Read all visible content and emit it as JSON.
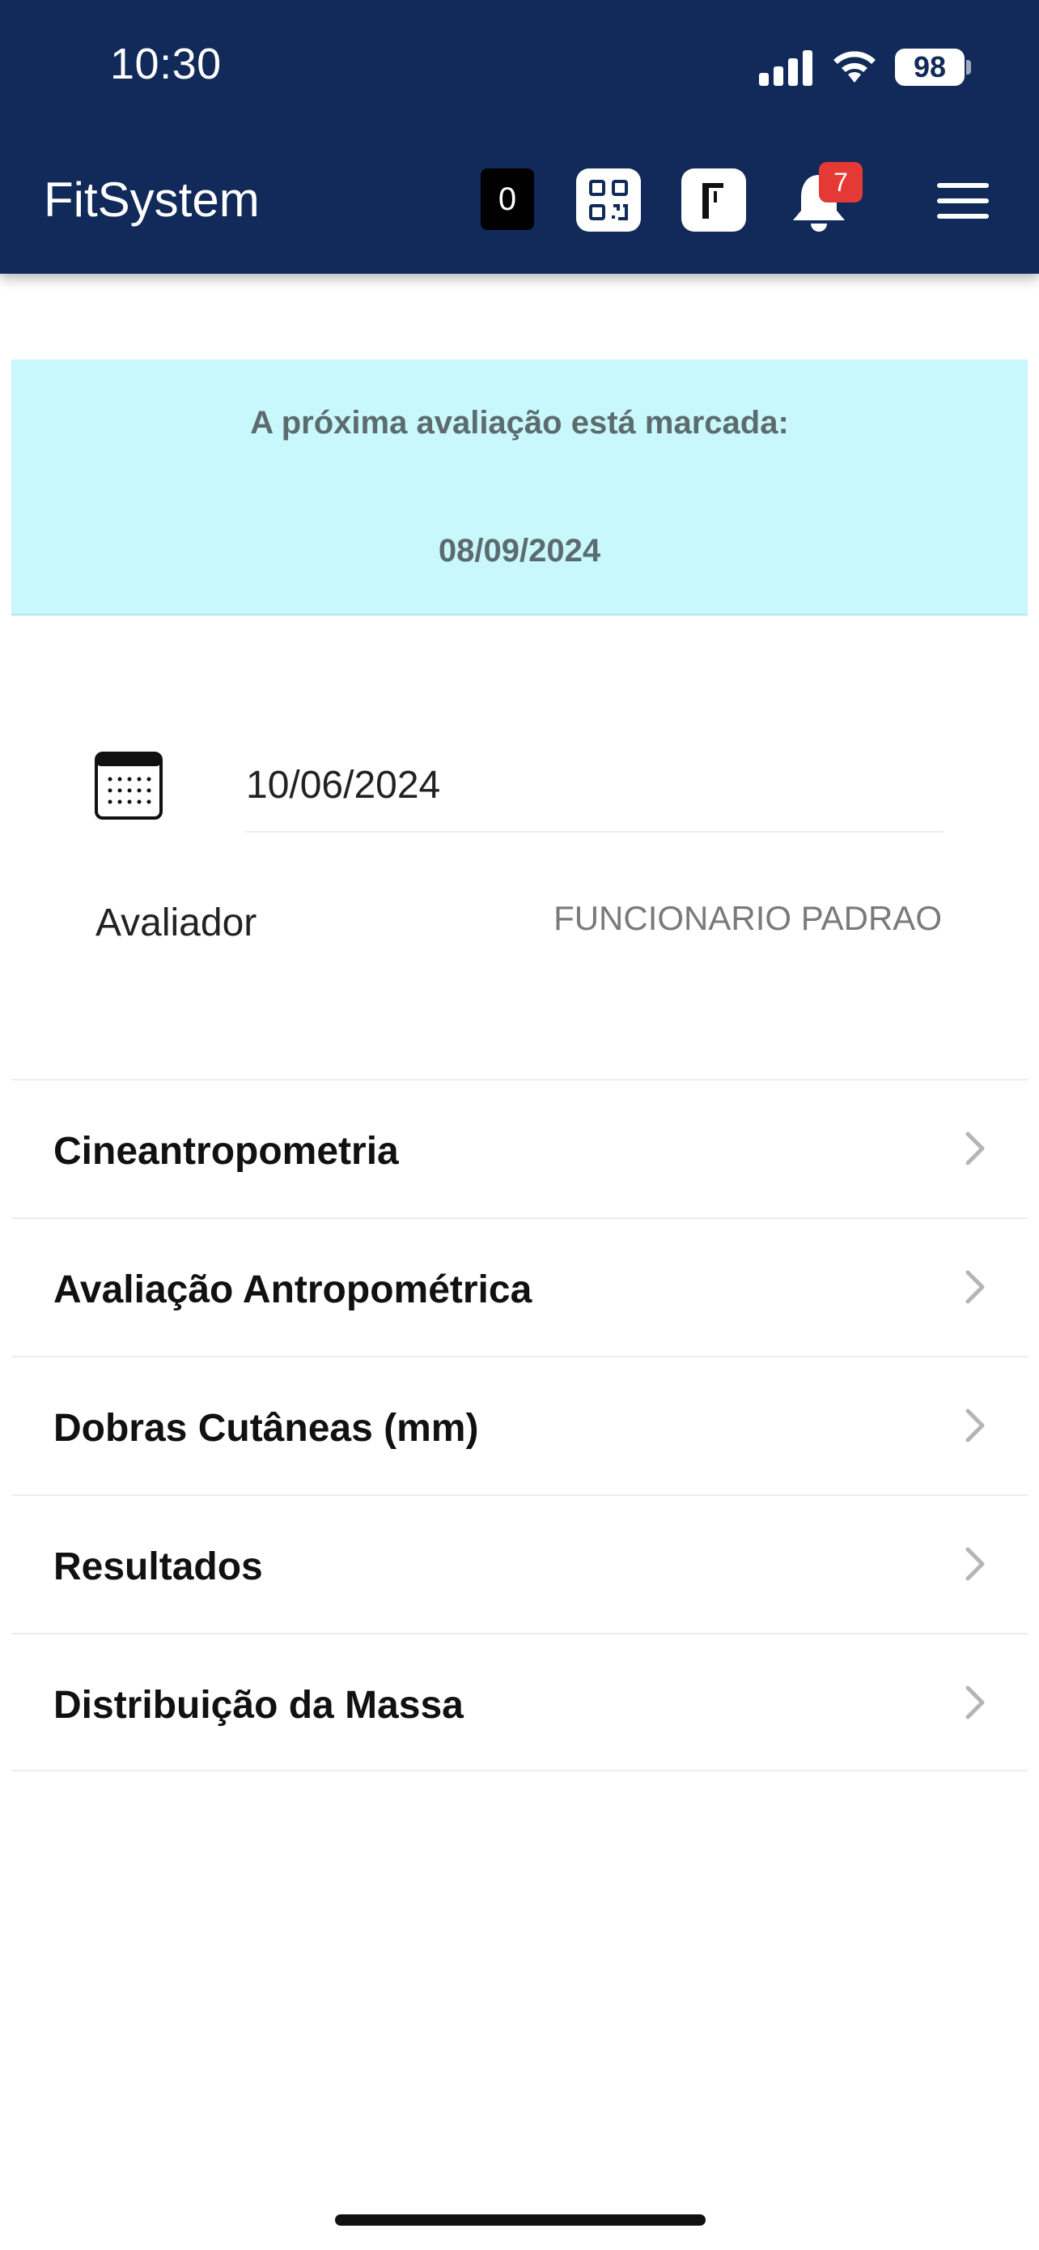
{
  "status_bar": {
    "time": "10:30",
    "battery": "98"
  },
  "header": {
    "title": "FitSystem",
    "counter": "0",
    "notification_count": "7",
    "icons": [
      "qr-code-icon",
      "turnstile-icon",
      "bell-icon",
      "hamburger-menu-icon"
    ]
  },
  "banner": {
    "title": "A próxima avaliação está marcada:",
    "date": "08/09/2024",
    "background": "#c8f8fb"
  },
  "evaluation": {
    "date": "10/06/2024",
    "evaluator_label": "Avaliador",
    "evaluator_name": "FUNCIONARIO PADRAO"
  },
  "menu": {
    "items": [
      {
        "label": "Cineantropometria"
      },
      {
        "label": "Avaliação Antropométrica"
      },
      {
        "label": "Dobras Cutâneas (mm)"
      },
      {
        "label": "Resultados"
      },
      {
        "label": "Distribuição da Massa"
      }
    ]
  },
  "colors": {
    "header": "#112a5a",
    "badge": "#e53935"
  }
}
